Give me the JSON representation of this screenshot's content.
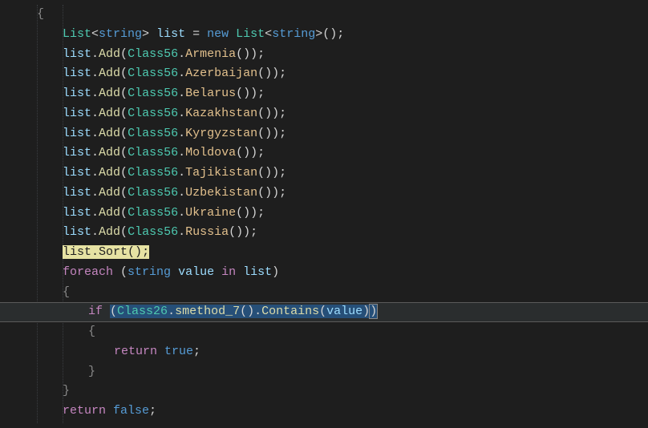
{
  "code": {
    "listType": "List",
    "typeParam": "string",
    "listVar": "list",
    "assign": "=",
    "newKw": "new",
    "ctorParens": "()",
    "semi": ";",
    "addMethod": "Add",
    "class56": "Class56",
    "countries": [
      "Armenia",
      "Azerbaijan",
      "Belarus",
      "Kazakhstan",
      "Kyrgyzstan",
      "Moldova",
      "Tajikistan",
      "Uzbekistan",
      "Ukraine",
      "Russia"
    ],
    "sortMethod": "Sort",
    "foreachKw": "foreach",
    "stringKw": "string",
    "loopVar": "value",
    "inKw": "in",
    "ifKw": "if",
    "class26": "Class26",
    "smethod7": "smethod_7",
    "containsMethod": "Contains",
    "returnKw": "return",
    "trueLit": "true",
    "falseLit": "false",
    "openBrace": "{",
    "closeBrace": "}"
  }
}
